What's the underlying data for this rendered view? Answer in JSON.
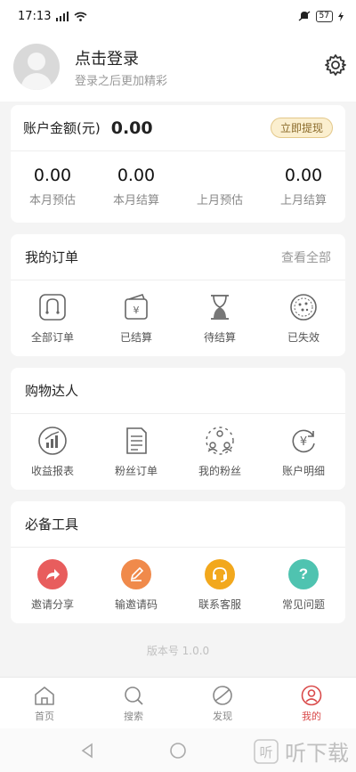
{
  "status_bar": {
    "time": "17:13",
    "battery": "57"
  },
  "header": {
    "title": "点击登录",
    "subtitle": "登录之后更加精彩"
  },
  "account": {
    "label": "账户金额(元)",
    "value": "0.00",
    "withdraw": "立即提现",
    "stats": [
      {
        "value": "0.00",
        "label": "本月预估"
      },
      {
        "value": "0.00",
        "label": "本月结算"
      },
      {
        "value": "",
        "label": "上月预估"
      },
      {
        "value": "0.00",
        "label": "上月结算"
      }
    ]
  },
  "orders": {
    "title": "我的订单",
    "view_all": "查看全部",
    "items": [
      {
        "label": "全部订单",
        "icon": "bag-icon"
      },
      {
        "label": "已结算",
        "icon": "wallet-icon"
      },
      {
        "label": "待结算",
        "icon": "hourglass-icon"
      },
      {
        "label": "已失效",
        "icon": "expired-stamp-icon"
      }
    ]
  },
  "shopping": {
    "title": "购物达人",
    "items": [
      {
        "label": "收益报表",
        "icon": "chart-icon"
      },
      {
        "label": "粉丝订单",
        "icon": "document-icon"
      },
      {
        "label": "我的粉丝",
        "icon": "fans-icon"
      },
      {
        "label": "账户明细",
        "icon": "yen-refresh-icon"
      }
    ]
  },
  "tools": {
    "title": "必备工具",
    "items": [
      {
        "label": "邀请分享",
        "icon": "share-icon",
        "color": "#e85d5d"
      },
      {
        "label": "输邀请码",
        "icon": "pencil-icon",
        "color": "#f08a4b"
      },
      {
        "label": "联系客服",
        "icon": "headset-icon",
        "color": "#f2a81d"
      },
      {
        "label": "常见问题",
        "icon": "question-icon",
        "color": "#4fc3b0"
      }
    ]
  },
  "version": "版本号 1.0.0",
  "tabbar": [
    {
      "label": "首页",
      "icon": "home-icon"
    },
    {
      "label": "搜索",
      "icon": "search-icon"
    },
    {
      "label": "发现",
      "icon": "discover-icon"
    },
    {
      "label": "我的",
      "icon": "profile-icon"
    }
  ],
  "watermark": "听下载",
  "colors": {
    "accent": "#d94a4a",
    "withdraw_bg": "#fbefcf"
  }
}
